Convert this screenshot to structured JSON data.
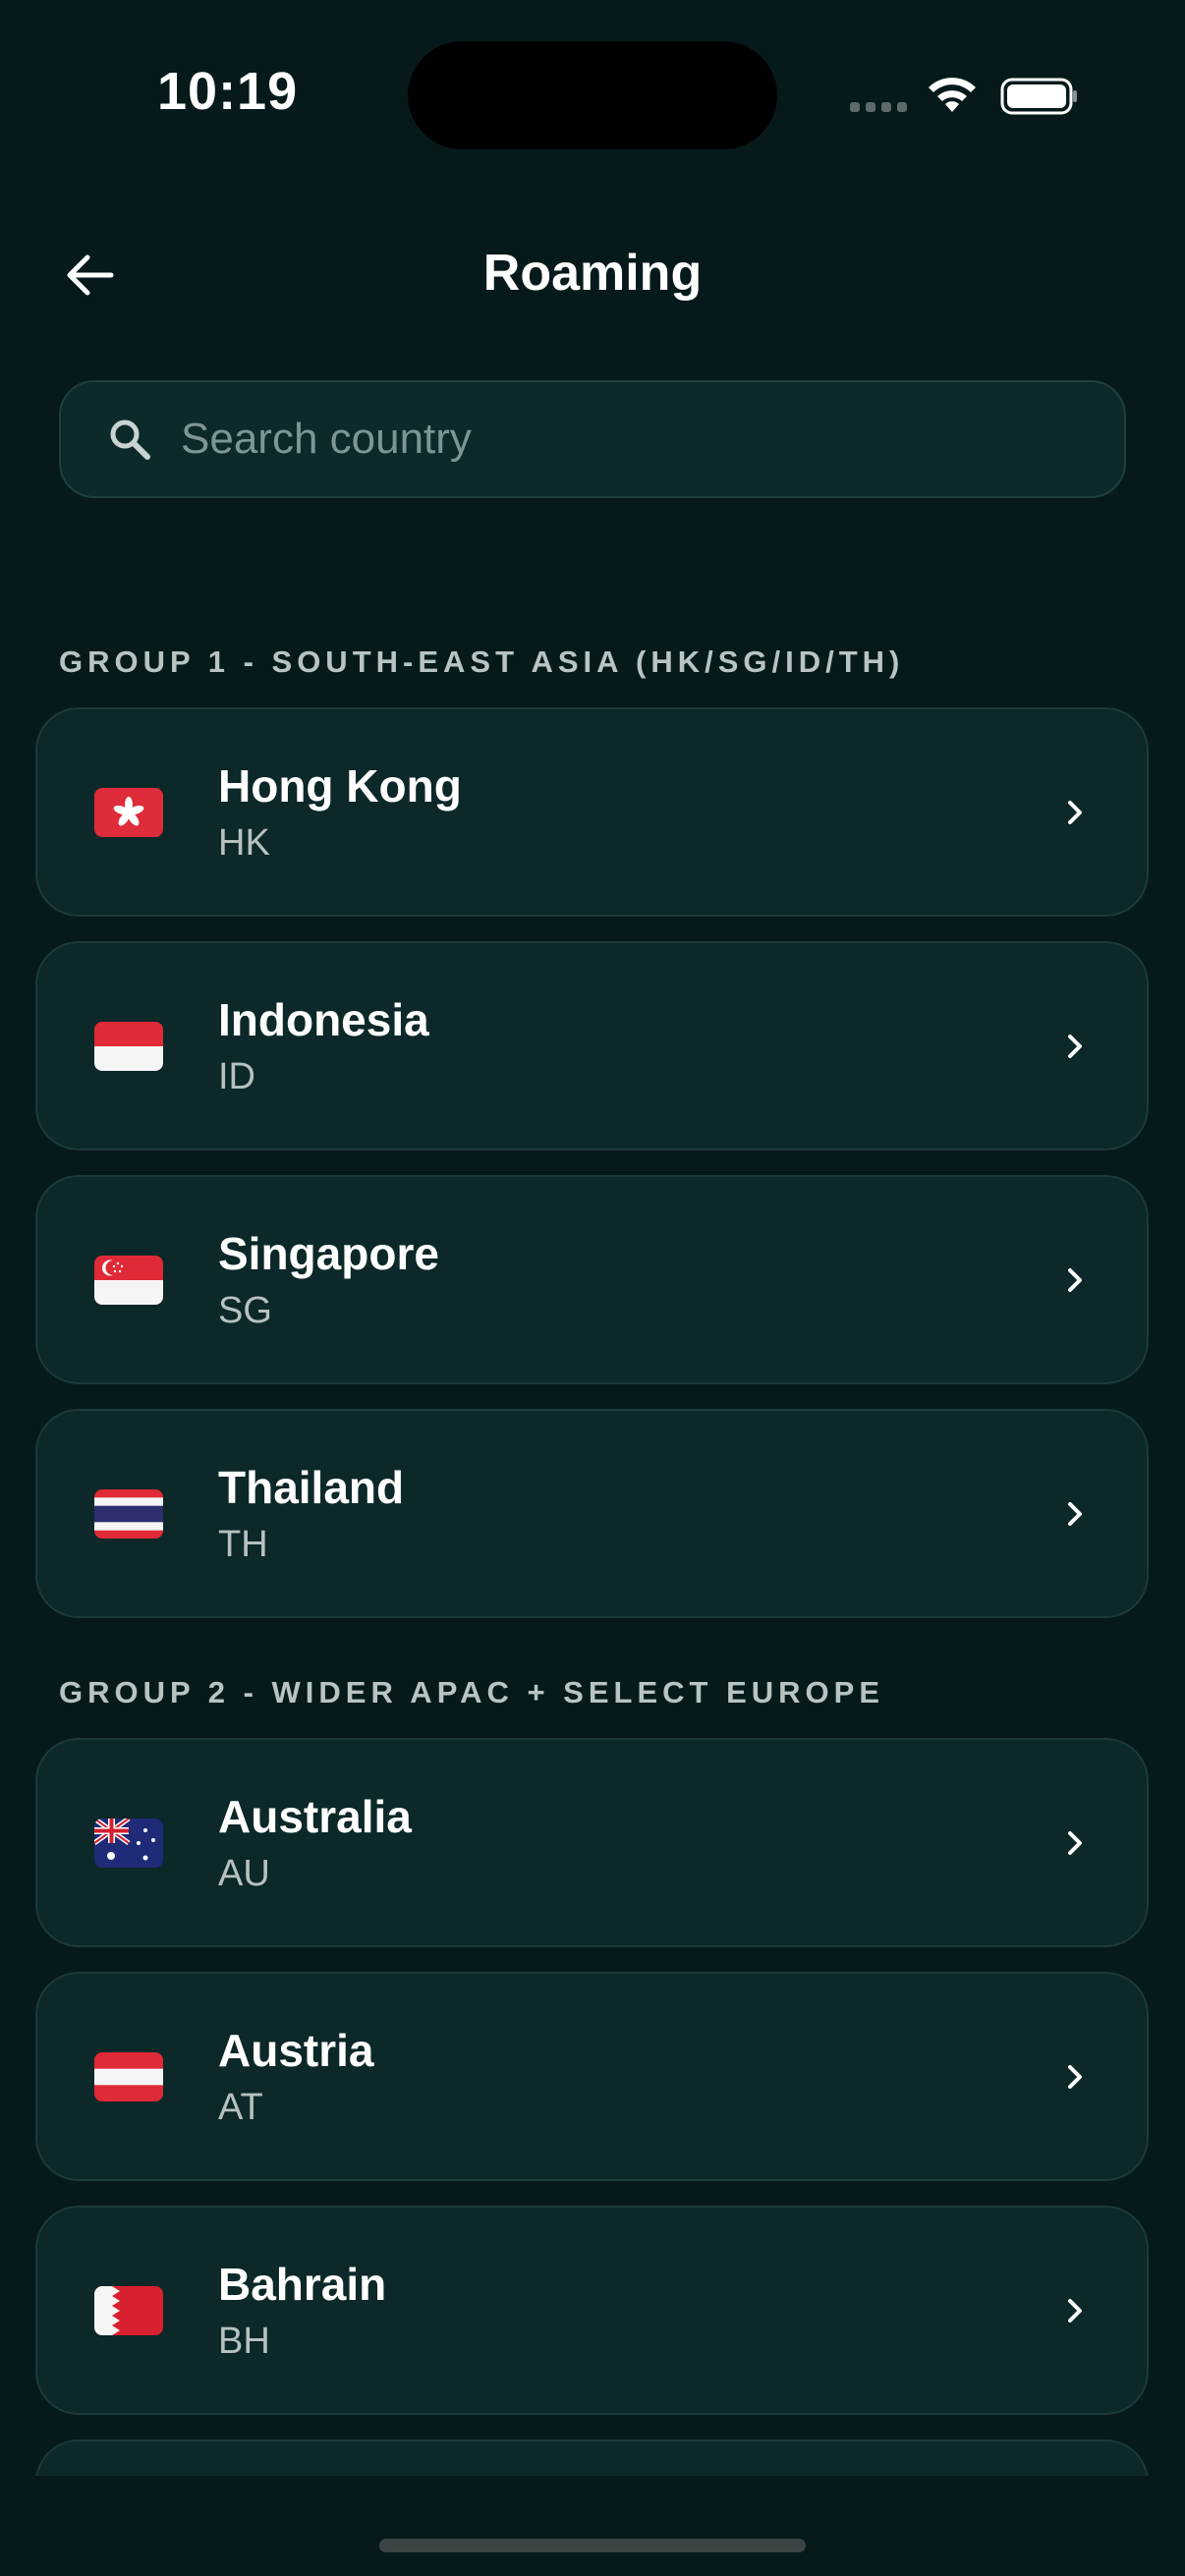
{
  "status_bar": {
    "time": "10:19"
  },
  "header": {
    "title": "Roaming"
  },
  "search": {
    "placeholder": "Search country"
  },
  "groups": [
    {
      "label": "GROUP 1 - SOUTH-EAST ASIA (HK/SG/ID/TH)",
      "countries": [
        {
          "name": "Hong Kong",
          "code": "HK"
        },
        {
          "name": "Indonesia",
          "code": "ID"
        },
        {
          "name": "Singapore",
          "code": "SG"
        },
        {
          "name": "Thailand",
          "code": "TH"
        }
      ]
    },
    {
      "label": "GROUP 2 - WIDER APAC + SELECT EUROPE",
      "countries": [
        {
          "name": "Australia",
          "code": "AU"
        },
        {
          "name": "Austria",
          "code": "AT"
        },
        {
          "name": "Bahrain",
          "code": "BH"
        }
      ]
    }
  ],
  "colors": {
    "background": "#061a1b",
    "card": "#0c2829",
    "muted_text": "#b6c1c0"
  }
}
